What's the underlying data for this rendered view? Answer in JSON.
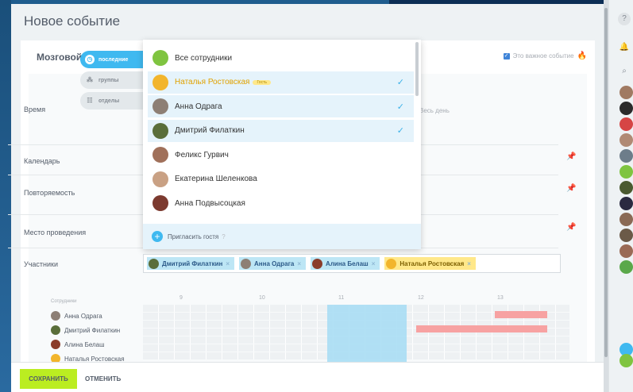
{
  "page": {
    "title": "Новое событие"
  },
  "event": {
    "name_partial": "Мозговой",
    "important_label": "Это важное событие"
  },
  "tabs": [
    {
      "label": "последние",
      "active": true
    },
    {
      "label": "группы",
      "active": false
    },
    {
      "label": "отделы",
      "active": false
    }
  ],
  "rows": {
    "time": "Время",
    "all_day": "Весь день",
    "calendar": "Календарь",
    "repeat": "Повторяемость",
    "location": "Место проведения",
    "participants": "Участники"
  },
  "dropdown": {
    "items": [
      {
        "name": "Все сотрудники",
        "selected": false,
        "color": "#7fc440"
      },
      {
        "name": "Наталья Ростовская",
        "badge": "Гость",
        "selected": true,
        "color": "#f2b52c"
      },
      {
        "name": "Анна Одрага",
        "selected": true,
        "color": "#8d7f75"
      },
      {
        "name": "Дмитрий Филаткин",
        "selected": true,
        "color": "#5a6e3a"
      },
      {
        "name": "Феликс Гурвич",
        "selected": false,
        "color": "#a0705a"
      },
      {
        "name": "Екатерина Шеленкова",
        "selected": false,
        "color": "#c9a184"
      },
      {
        "name": "Анна Подвысоцкая",
        "selected": false,
        "color": "#7c3a2f"
      }
    ],
    "invite_label": "Пригласить гостя"
  },
  "participant_chips": [
    {
      "name": "Дмитрий Филаткин",
      "color": "#5a6e3a",
      "gold": false
    },
    {
      "name": "Анна Одрага",
      "color": "#8d7f75",
      "gold": false
    },
    {
      "name": "Алина Белаш",
      "color": "#8a3c2a",
      "gold": false
    },
    {
      "name": "Наталья Ростовская",
      "color": "#f2b52c",
      "gold": true
    }
  ],
  "planner": {
    "header": "Сотрудники",
    "hours": [
      "9",
      "10",
      "11",
      "12",
      "13"
    ],
    "people": [
      {
        "name": "Анна Одрага",
        "color": "#8d7f75"
      },
      {
        "name": "Дмитрий Филаткин",
        "color": "#5a6e3a"
      },
      {
        "name": "Алина Белаш",
        "color": "#8a3c2a"
      },
      {
        "name": "Наталья Ростовская",
        "color": "#f2b52c"
      }
    ]
  },
  "footer": {
    "save": "СОХРАНИТЬ",
    "cancel": "ОТМЕНИТЬ"
  },
  "colors": {
    "accent": "#3fb9f0",
    "save": "#bbed21",
    "busy": "#f7a2a2",
    "selection": "#a5dcf3"
  }
}
